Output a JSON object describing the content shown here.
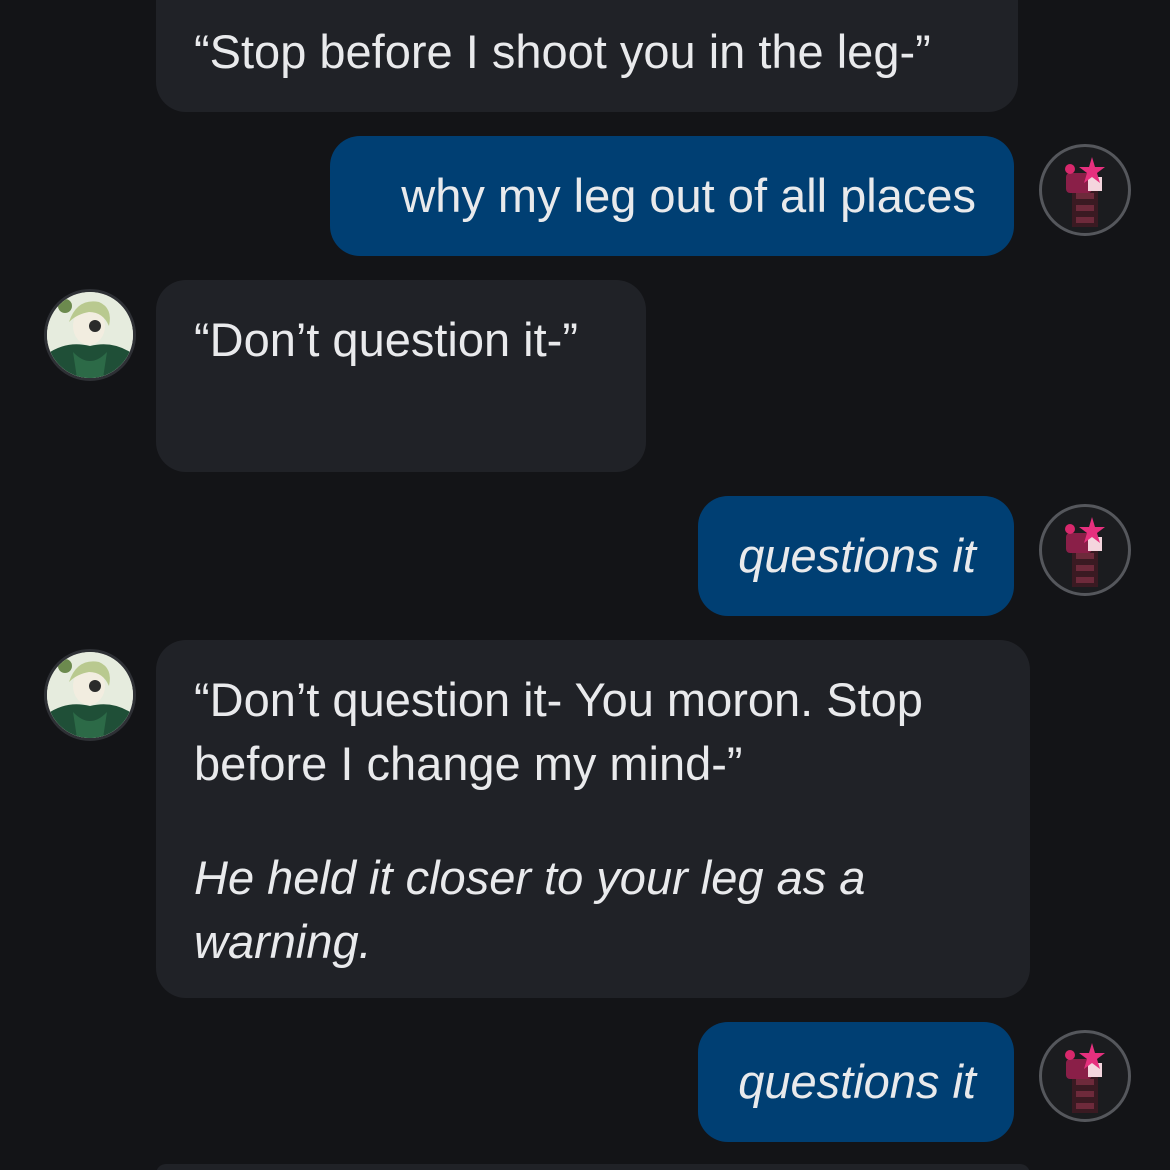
{
  "messages": [
    {
      "role": "bot",
      "text": "“Stop before I shoot you in the leg-”"
    },
    {
      "role": "user",
      "text": "why my leg out of all places"
    },
    {
      "role": "bot",
      "text": "“Don’t question it-”"
    },
    {
      "role": "user",
      "text": "questions it",
      "italic": true
    },
    {
      "role": "bot",
      "paragraphs": [
        "“Don’t question it- You moron. Stop before I change my mind-”",
        "He held it closer to your leg as a warning."
      ]
    },
    {
      "role": "user",
      "text": "questions it",
      "italic": true
    }
  ],
  "avatars": {
    "user": "robot-character-avatar",
    "bot": "green-haired-character-avatar"
  },
  "colors": {
    "background": "#131417",
    "bot_bubble": "#202227",
    "user_bubble": "#003f73",
    "text": "#e9eaec"
  }
}
